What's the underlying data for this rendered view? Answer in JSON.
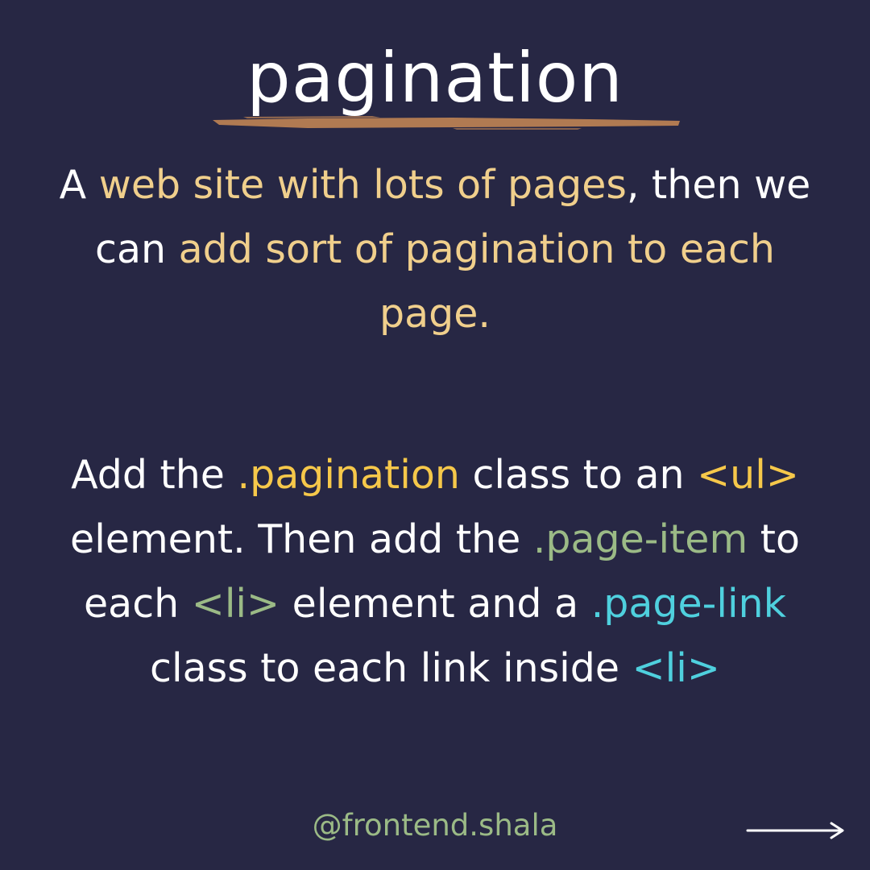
{
  "title": "pagination",
  "colors": {
    "background": "#272744",
    "text": "#ffffff",
    "sand": "#f0cf8c",
    "yellow": "#f6c84a",
    "green": "#9bba86",
    "cyan": "#4fd0de",
    "brush": "#b07a52"
  },
  "para1": {
    "s1": "A ",
    "h1": "web site with lots of pages",
    "s2": ", then we can ",
    "h2": "add sort of pagination to each page."
  },
  "para2": {
    "s1": "Add the ",
    "h1": ".pagination",
    "s2": " class to an ",
    "h2": "<ul>",
    "s3": " element. Then add the ",
    "h3": ".page-item",
    "s4": " to each ",
    "h4": "<li>",
    "s5": " element and a ",
    "h5": ".page-link",
    "s6": " class to each link inside ",
    "h6": "<li>"
  },
  "footer": {
    "handle": "@frontend.shala",
    "next_icon": "right-arrow-icon"
  }
}
